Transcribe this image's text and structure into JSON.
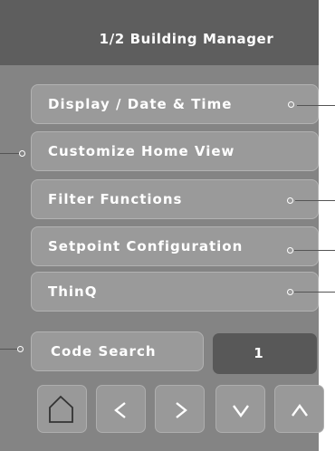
{
  "header": {
    "title": "1/2 Building Manager"
  },
  "menu": {
    "items": [
      {
        "label": "Display / Date & Time"
      },
      {
        "label": "Customize Home View"
      },
      {
        "label": "Filter Functions"
      },
      {
        "label": "Setpoint Configuration"
      },
      {
        "label": "ThinQ"
      }
    ]
  },
  "code_search": {
    "label": "Code Search",
    "value": "1"
  },
  "nav": {
    "icons": [
      "home-icon",
      "chevron-left-icon",
      "chevron-right-icon",
      "chevron-down-icon",
      "chevron-up-icon"
    ]
  },
  "colors": {
    "panel": "#848484",
    "header": "#5e5e5e",
    "button": "#9a9a9a",
    "code_field": "#585858"
  }
}
